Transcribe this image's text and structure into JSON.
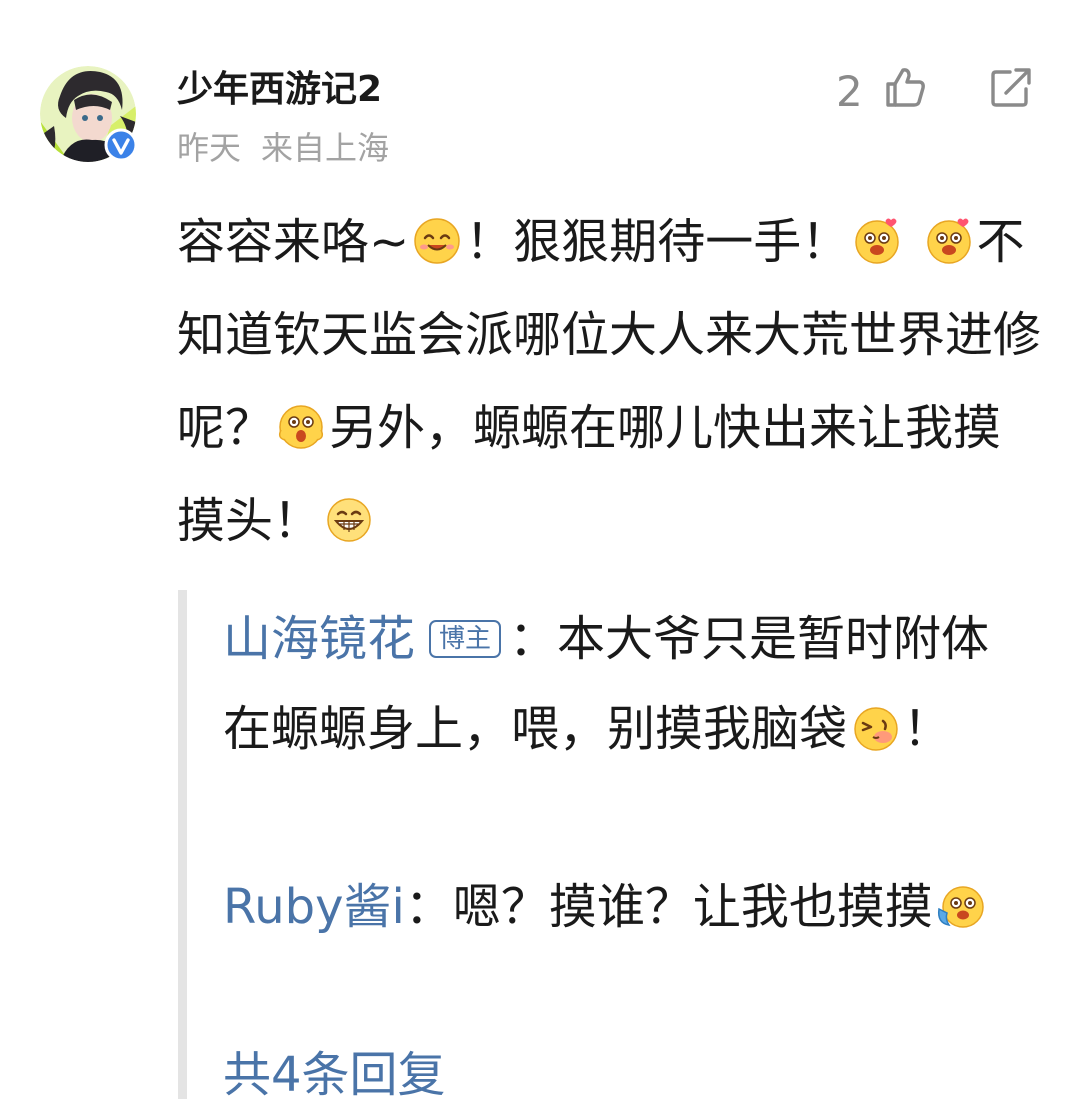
{
  "comment": {
    "username": "少年西游记2",
    "time": "昨天",
    "location": "来自上海",
    "like_count": "2",
    "text_1": "容容来咯~",
    "text_2": "！狠狠期待一手！",
    "text_3": "不知道钦天监会派哪位大人来大荒世界进修呢？",
    "text_4": "另外，螈螈在哪儿快出来让我摸摸头！"
  },
  "replies": [
    {
      "name": "山海镜花",
      "badge": "博主",
      "separator": "：",
      "text": "本大爷只是暂时附体在螈螈身上，喂，别摸我脑袋",
      "text_after": "！"
    },
    {
      "name": "Ruby酱i",
      "separator": "：",
      "text": "嗯？摸谁？让我也摸摸"
    }
  ],
  "more_replies": "共4条回复",
  "icons": {
    "like": "thumbs-up-icon",
    "share": "share-icon",
    "verified": "verified-badge-icon"
  },
  "colors": {
    "link": "#4a74a8",
    "meta": "#a3a3a3",
    "verified": "#3b82e8"
  }
}
